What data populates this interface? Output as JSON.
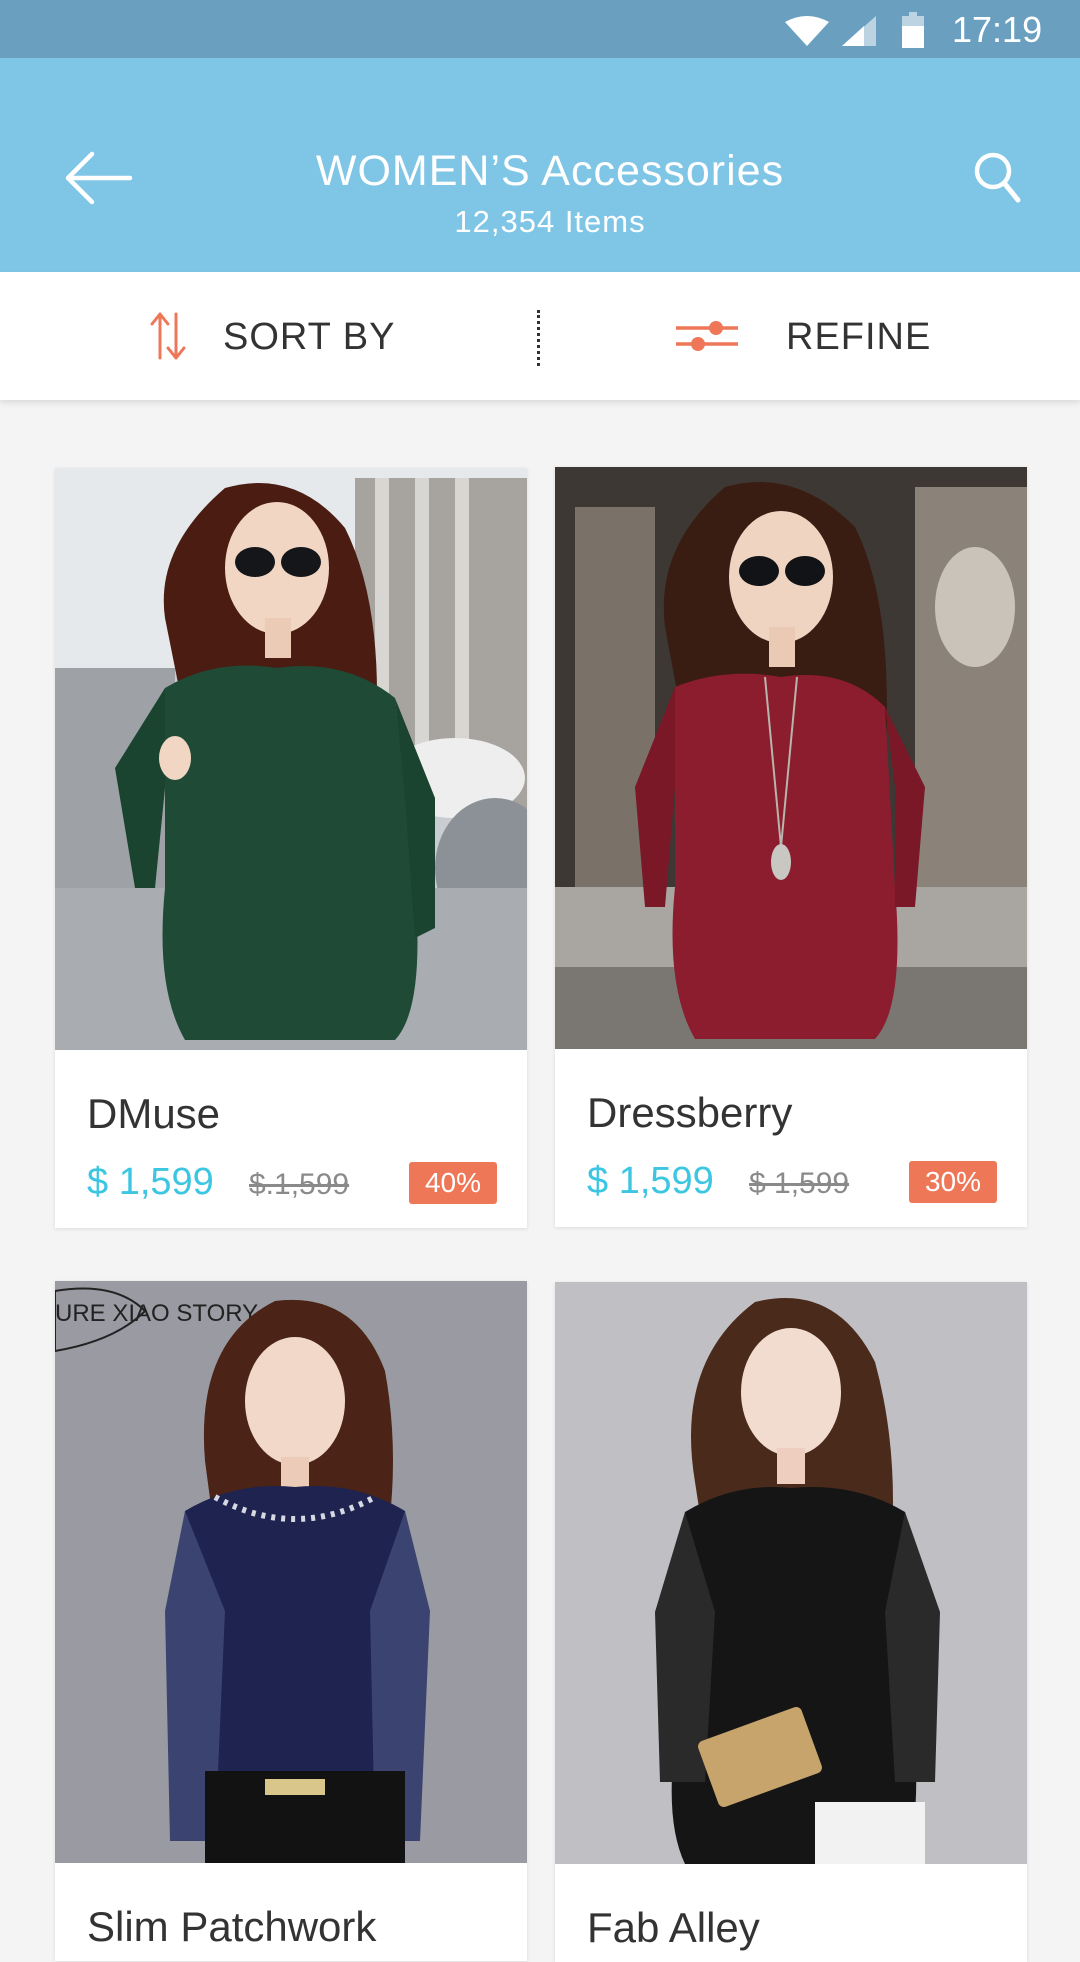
{
  "status_bar": {
    "time": "17:19",
    "icons": [
      "wifi-icon",
      "signal-icon",
      "battery-icon"
    ]
  },
  "header": {
    "title": "WOMEN’S Accessories",
    "subtitle": "12,354 Items",
    "back_icon": "arrow-left-icon",
    "search_icon": "search-icon"
  },
  "toolbar": {
    "sort_label": "SORT BY",
    "refine_label": "REFINE",
    "sort_icon": "sort-arrows-icon",
    "refine_icon": "sliders-icon"
  },
  "products": [
    {
      "name": "DMuse",
      "price": "$ 1,599",
      "old_price": "$.1,599",
      "discount": "40%"
    },
    {
      "name": "Dressberry",
      "price": "$ 1,599",
      "old_price": "$ 1,599",
      "discount": "30%"
    },
    {
      "name": "Slim Patchwork",
      "photo_text": "URE XIAO STORY"
    },
    {
      "name": "Fab Alley"
    }
  ],
  "colors": {
    "status_bar": "#6a9fbf",
    "app_bar": "#7fc5e6",
    "accent_orange": "#ee7758",
    "price_cyan": "#3cc6e1",
    "product_1_top": "#1f4a36",
    "product_2_top": "#8c1d2e",
    "product_3_top": "#1e2350",
    "product_4_top": "#151515"
  }
}
